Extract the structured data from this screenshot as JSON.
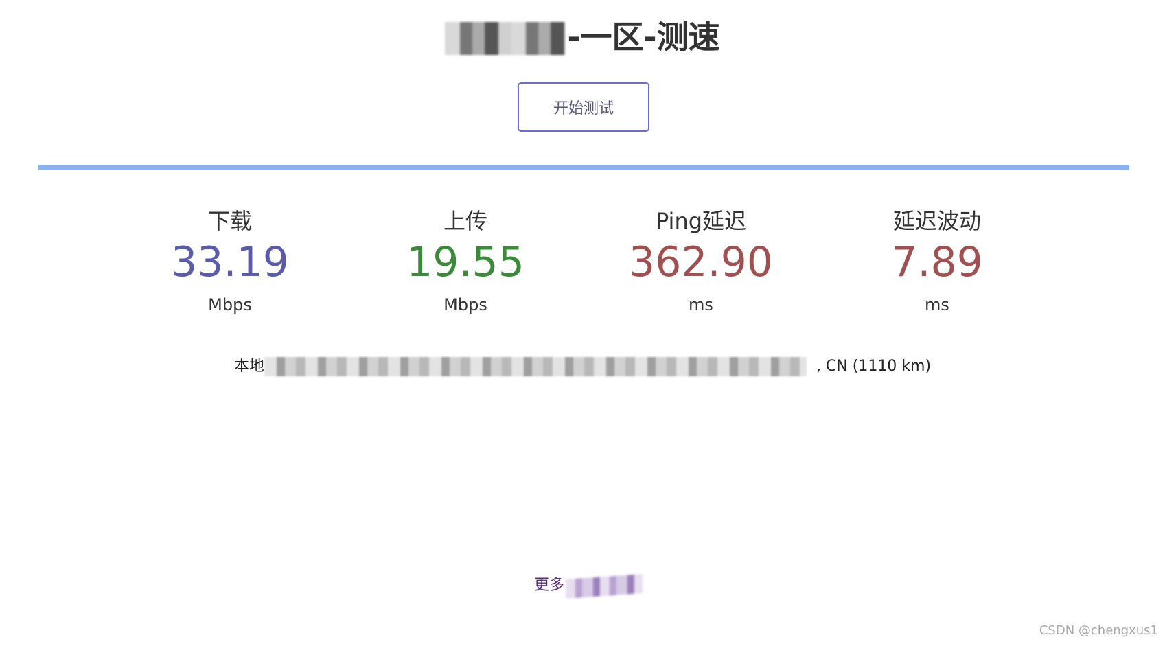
{
  "header": {
    "title_suffix": "-一区-测速"
  },
  "controls": {
    "start_button_label": "开始测试"
  },
  "progress": {
    "fraction": 1.0,
    "color": "#8ab0f0"
  },
  "metrics": [
    {
      "label": "下载",
      "value": "33.19",
      "unit": "Mbps",
      "color": "#5b5bab"
    },
    {
      "label": "上传",
      "value": "19.55",
      "unit": "Mbps",
      "color": "#3a8a3a"
    },
    {
      "label": "Ping延迟",
      "value": "362.90",
      "unit": "ms",
      "color": "#a05050"
    },
    {
      "label": "延迟波动",
      "value": "7.89",
      "unit": "ms",
      "color": "#a05050"
    }
  ],
  "server": {
    "visible_prefix": "本地",
    "visible_suffix": ", CN (1110 km)"
  },
  "footer": {
    "more_link_prefix": "更多",
    "watermark": "CSDN @chengxus1"
  }
}
